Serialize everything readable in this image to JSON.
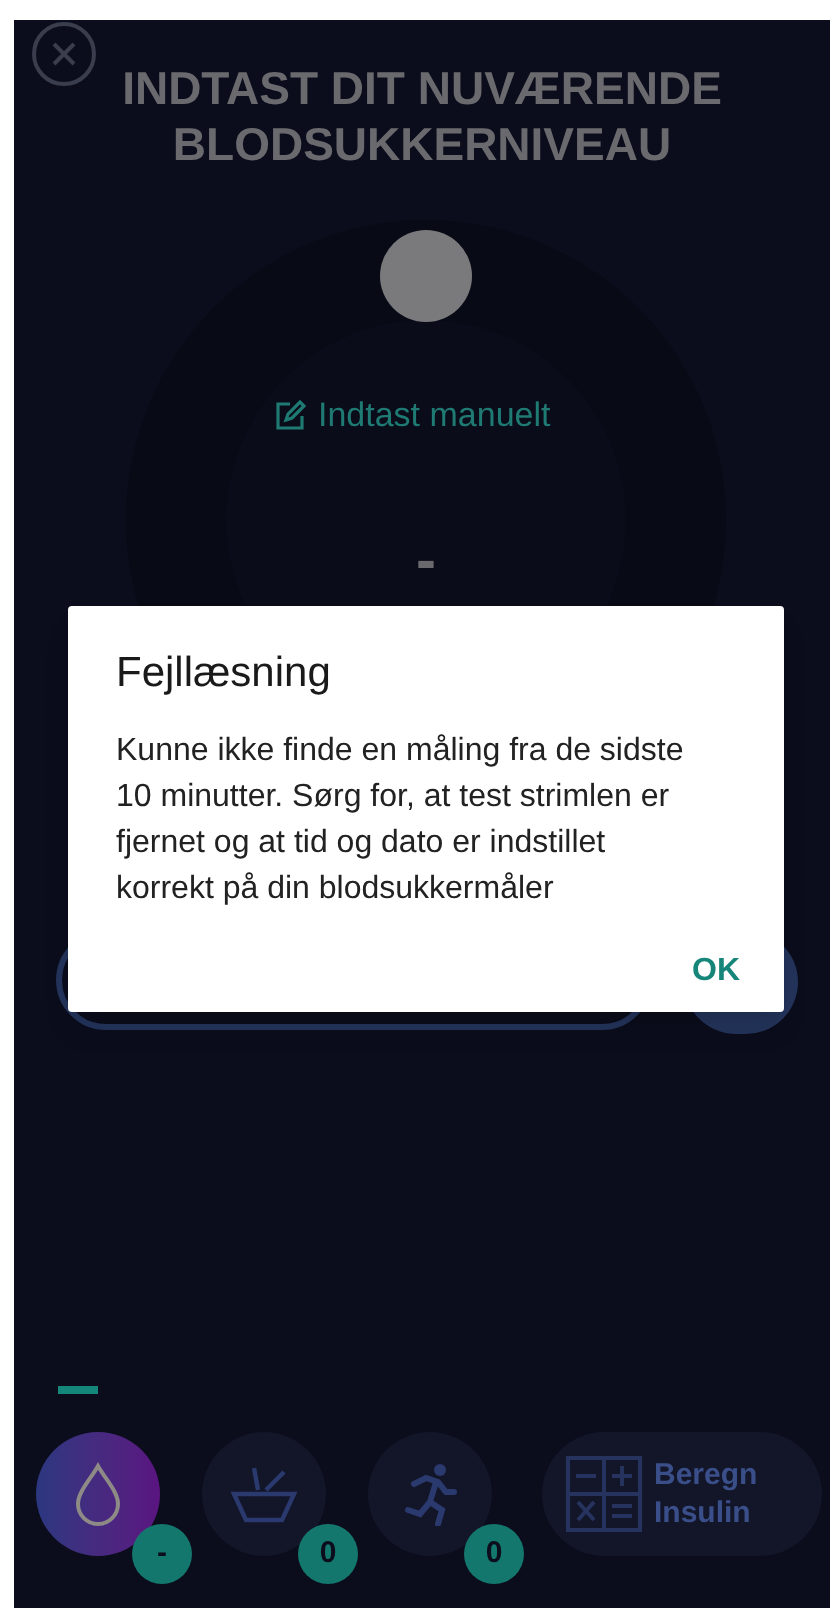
{
  "header": {
    "title": "INDTAST DIT NUVÆRENDE BLODSUKKERNIVEAU"
  },
  "dial": {
    "manual_link": "Indtast manuelt",
    "value": "-"
  },
  "dialog": {
    "title": "Fejllæsning",
    "message": "Kunne ikke finde en måling fra de sidste 10 minutter. Sørg for, at test strimlen er fjernet og at tid og dato er indstillet korrekt på din blodsukkermåler",
    "button": "OK"
  },
  "bottom_nav": {
    "items": [
      {
        "kind": "drop",
        "badge": "-",
        "selected": true
      },
      {
        "kind": "bowl",
        "badge": "0",
        "selected": false
      },
      {
        "kind": "runner",
        "badge": "0",
        "selected": false
      }
    ],
    "calculator": {
      "label": "Beregn Insulin"
    }
  }
}
